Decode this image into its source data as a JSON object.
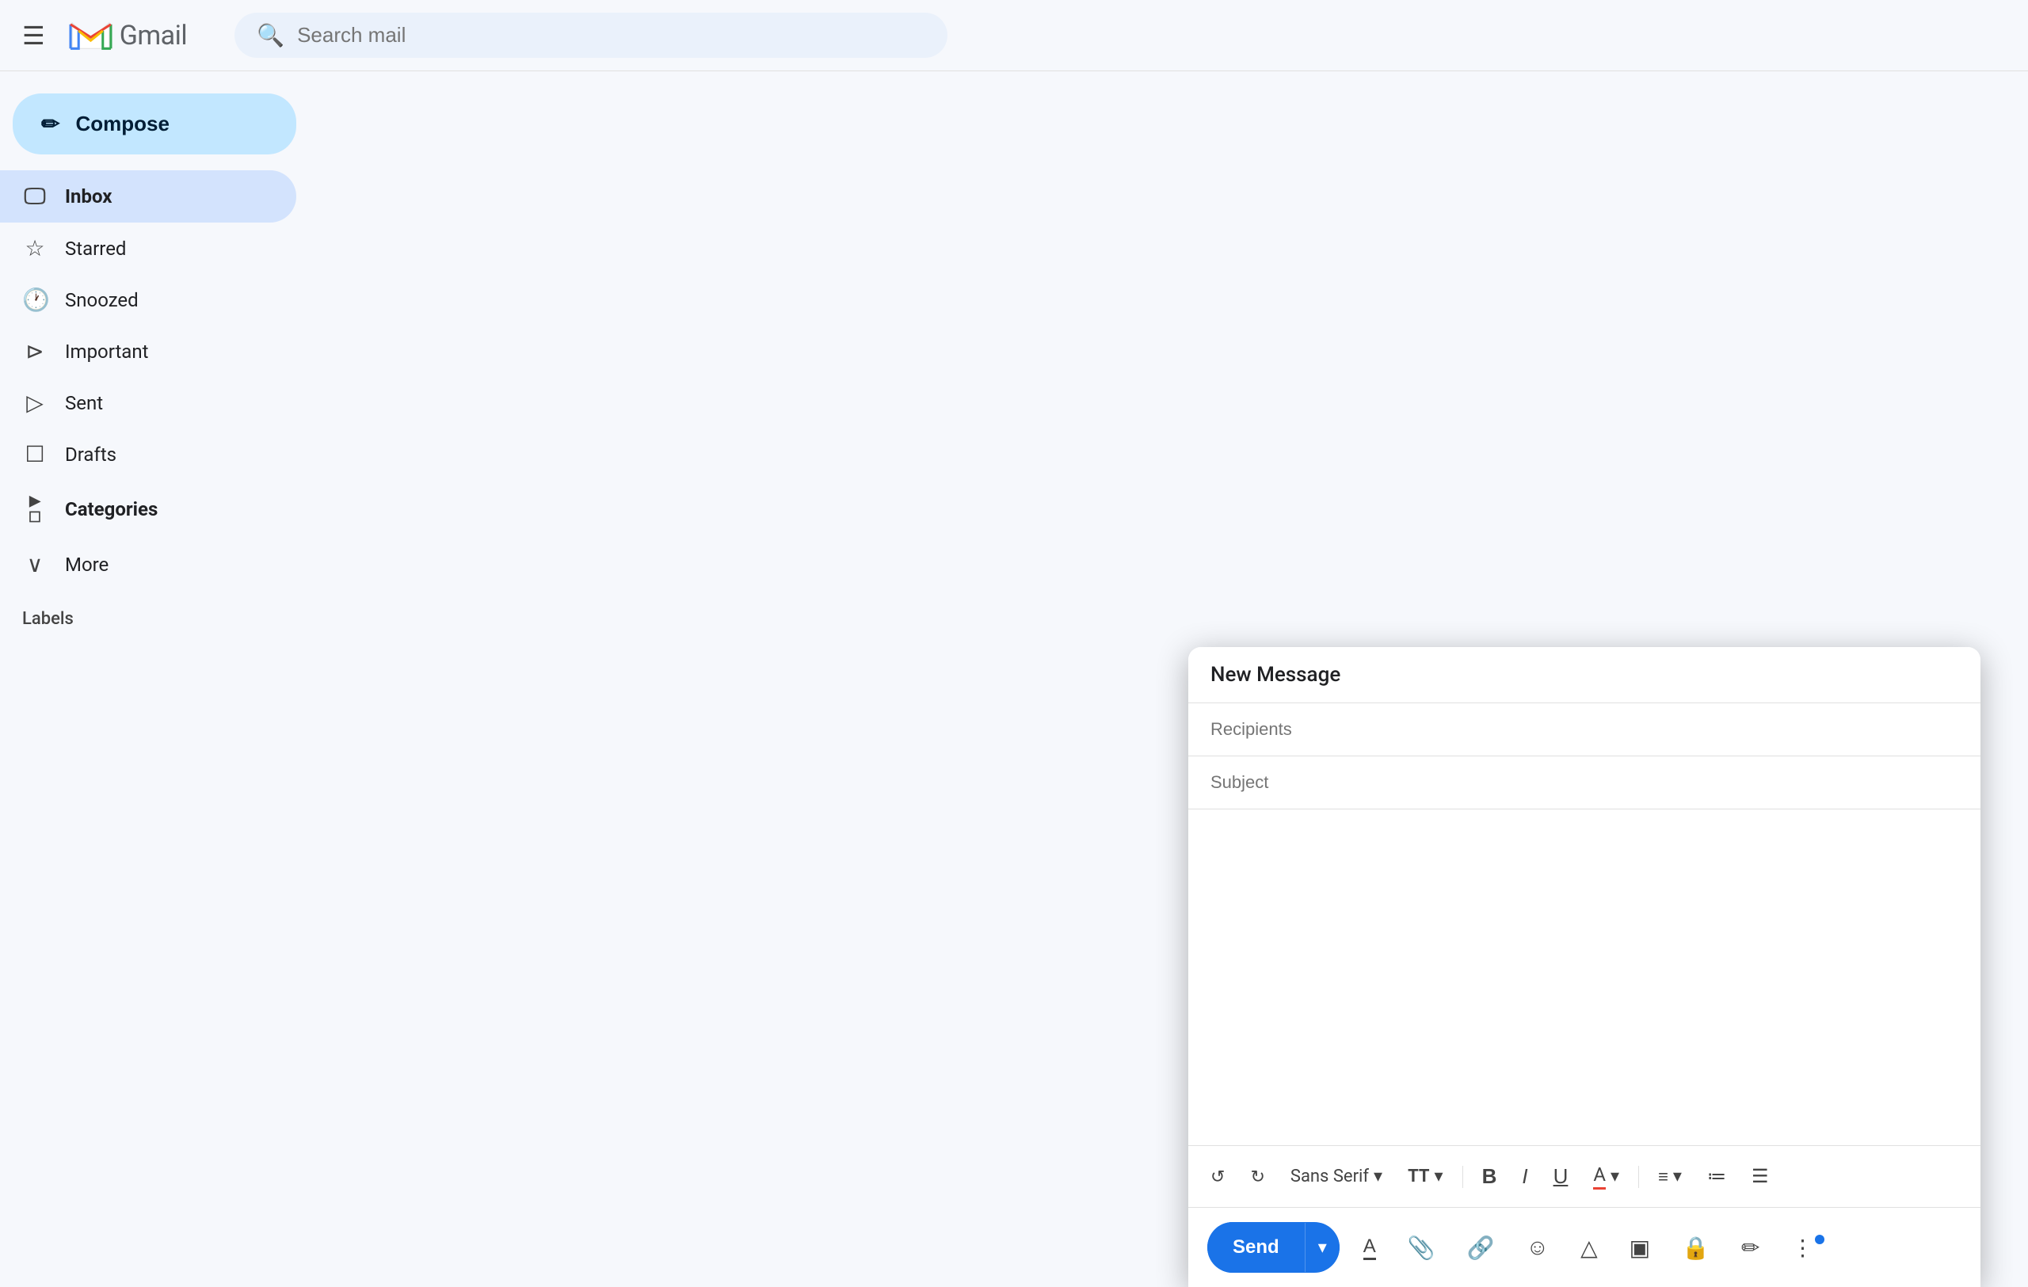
{
  "header": {
    "menu_label": "☰",
    "gmail_text": "Gmail",
    "search_placeholder": "Search mail"
  },
  "sidebar": {
    "compose_label": "Compose",
    "nav_items": [
      {
        "id": "inbox",
        "label": "Inbox",
        "icon": "🖵",
        "active": true
      },
      {
        "id": "starred",
        "label": "Starred",
        "icon": "☆",
        "active": false
      },
      {
        "id": "snoozed",
        "label": "Snoozed",
        "icon": "🕐",
        "active": false
      },
      {
        "id": "important",
        "label": "Important",
        "icon": "⊳",
        "active": false
      },
      {
        "id": "sent",
        "label": "Sent",
        "icon": "▷",
        "active": false
      },
      {
        "id": "drafts",
        "label": "Drafts",
        "icon": "☐",
        "active": false
      },
      {
        "id": "categories",
        "label": "Categories",
        "icon": "⊳☐",
        "active": false,
        "bold": true
      },
      {
        "id": "more",
        "label": "More",
        "icon": "∨",
        "active": false
      }
    ],
    "labels_label": "Labels"
  },
  "compose": {
    "title": "New Message",
    "recipients_placeholder": "Recipients",
    "subject_placeholder": "Subject",
    "body_placeholder": "",
    "send_label": "Send",
    "send_dropdown_icon": "▾",
    "toolbar": {
      "undo_label": "↺",
      "redo_label": "↻",
      "font_label": "Sans Serif",
      "font_dropdown": "▾",
      "size_label": "TT",
      "size_dropdown": "▾",
      "bold_label": "B",
      "italic_label": "I",
      "underline_label": "U",
      "font_color_label": "A",
      "align_label": "≡",
      "list_numbered_label": "≡",
      "list_bullet_label": "≡"
    },
    "actions": {
      "font_color": "A",
      "attach": "📎",
      "link": "🔗",
      "emoji": "☺",
      "drive": "△",
      "photo": "▣",
      "lock": "🔒",
      "signature": "✏",
      "more": "⋮"
    }
  }
}
